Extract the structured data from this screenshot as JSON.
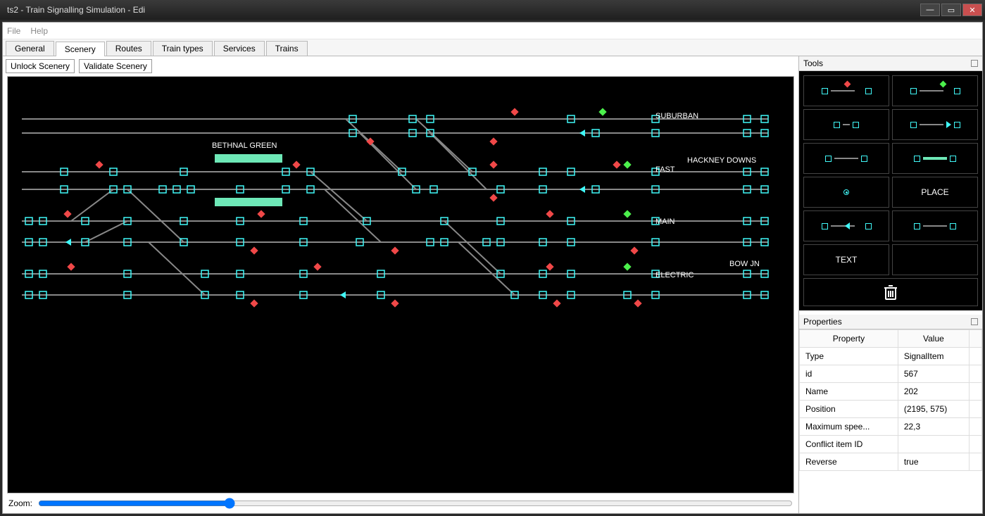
{
  "window": {
    "title": "ts2 - Train Signalling Simulation - Edi"
  },
  "menu": {
    "file": "File",
    "help": "Help"
  },
  "tabs": [
    {
      "label": "General"
    },
    {
      "label": "Scenery"
    },
    {
      "label": "Routes"
    },
    {
      "label": "Train types"
    },
    {
      "label": "Services"
    },
    {
      "label": "Trains"
    }
  ],
  "active_tab": 1,
  "scenery_toolbar": {
    "unlock": "Unlock Scenery",
    "validate": "Validate Scenery"
  },
  "zoom": {
    "label": "Zoom:"
  },
  "scenery_labels": {
    "bethnal": "BETHNAL GREEN",
    "suburban": "SUBURBAN",
    "hackney": "HACKNEY DOWNS",
    "fast": "FAST",
    "main": "MAIN",
    "bowjn": "BOW JN",
    "electric": "ELECTRIC"
  },
  "tools": {
    "header": "Tools",
    "place": "PLACE",
    "text": "TEXT"
  },
  "properties": {
    "header": "Properties",
    "columns": {
      "prop": "Property",
      "val": "Value"
    },
    "rows": [
      {
        "p": "Type",
        "v": "SignalItem"
      },
      {
        "p": "id",
        "v": "567"
      },
      {
        "p": "Name",
        "v": "202"
      },
      {
        "p": "Position",
        "v": "(2195, 575)"
      },
      {
        "p": "Maximum spee...",
        "v": "22,3"
      },
      {
        "p": "Conflict item ID",
        "v": ""
      },
      {
        "p": "Reverse",
        "v": "true"
      }
    ]
  }
}
